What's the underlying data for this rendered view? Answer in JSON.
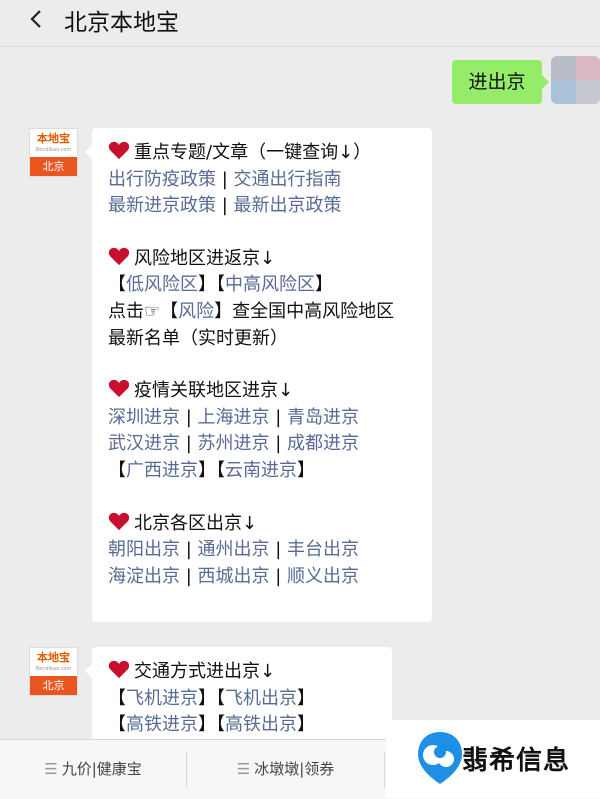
{
  "header": {
    "title": "北京本地宝"
  },
  "my_message": {
    "text": "进出京"
  },
  "bot_avatar": {
    "logo_text": "本地宝",
    "logo_domain": "Bendibao.com",
    "city": "北京"
  },
  "message1": {
    "sections": [
      {
        "lines": [
          [
            {
              "heart": true
            },
            {
              "t": "重点专题/文章（一键查询↓）",
              "c": "txt"
            }
          ],
          [
            {
              "t": "出行防疫政策",
              "c": "lnk"
            },
            {
              "t": " | ",
              "c": "txt"
            },
            {
              "t": "交通出行指南",
              "c": "lnk"
            }
          ],
          [
            {
              "t": "最新进京政策",
              "c": "lnk"
            },
            {
              "t": " | ",
              "c": "txt"
            },
            {
              "t": "最新出京政策",
              "c": "lnk"
            }
          ]
        ]
      },
      {
        "lines": [
          [
            {
              "heart": true
            },
            {
              "t": "风险地区进返京↓",
              "c": "txt"
            }
          ],
          [
            {
              "t": "【",
              "c": "txt"
            },
            {
              "t": "低风险区",
              "c": "lnk"
            },
            {
              "t": "】【",
              "c": "txt"
            },
            {
              "t": "中高风险区",
              "c": "lnk"
            },
            {
              "t": "】",
              "c": "txt"
            }
          ],
          [
            {
              "t": "点击☞【",
              "c": "txt"
            },
            {
              "t": "风险",
              "c": "lnk"
            },
            {
              "t": "】查全国中高风险地区",
              "c": "txt"
            }
          ],
          [
            {
              "t": "最新名单（实时更新）",
              "c": "txt"
            }
          ]
        ]
      },
      {
        "lines": [
          [
            {
              "heart": true
            },
            {
              "t": "疫情关联地区进京↓",
              "c": "txt"
            }
          ],
          [
            {
              "t": "深圳进京",
              "c": "lnk"
            },
            {
              "t": " | ",
              "c": "txt"
            },
            {
              "t": "上海进京",
              "c": "lnk"
            },
            {
              "t": " | ",
              "c": "txt"
            },
            {
              "t": "青岛进京",
              "c": "lnk"
            }
          ],
          [
            {
              "t": "武汉进京",
              "c": "lnk"
            },
            {
              "t": " | ",
              "c": "txt"
            },
            {
              "t": "苏州进京",
              "c": "lnk"
            },
            {
              "t": " | ",
              "c": "txt"
            },
            {
              "t": "成都进京",
              "c": "lnk"
            }
          ],
          [
            {
              "t": "【",
              "c": "txt"
            },
            {
              "t": "广西进京",
              "c": "lnk"
            },
            {
              "t": "】【",
              "c": "txt"
            },
            {
              "t": "云南进京",
              "c": "lnk"
            },
            {
              "t": "】",
              "c": "txt"
            }
          ]
        ]
      },
      {
        "lines": [
          [
            {
              "heart": true
            },
            {
              "t": "北京各区出京↓",
              "c": "txt"
            }
          ],
          [
            {
              "t": "朝阳出京",
              "c": "lnk"
            },
            {
              "t": " | ",
              "c": "txt"
            },
            {
              "t": "通州出京",
              "c": "lnk"
            },
            {
              "t": " | ",
              "c": "txt"
            },
            {
              "t": "丰台出京",
              "c": "lnk"
            }
          ],
          [
            {
              "t": "海淀出京",
              "c": "lnk"
            },
            {
              "t": " | ",
              "c": "txt"
            },
            {
              "t": "西城出京",
              "c": "lnk"
            },
            {
              "t": " | ",
              "c": "txt"
            },
            {
              "t": "顺义出京",
              "c": "lnk"
            }
          ]
        ]
      }
    ]
  },
  "message2": {
    "sections": [
      {
        "lines": [
          [
            {
              "heart": true
            },
            {
              "t": "交通方式进出京↓",
              "c": "txt"
            }
          ],
          [
            {
              "t": "【",
              "c": "txt"
            },
            {
              "t": "飞机进京",
              "c": "lnk"
            },
            {
              "t": "】【",
              "c": "txt"
            },
            {
              "t": "飞机出京",
              "c": "lnk"
            },
            {
              "t": "】",
              "c": "txt"
            }
          ],
          [
            {
              "t": "【",
              "c": "txt"
            },
            {
              "t": "高铁进京",
              "c": "lnk"
            },
            {
              "t": "】【",
              "c": "txt"
            },
            {
              "t": "高铁出京",
              "c": "lnk"
            },
            {
              "t": "】",
              "c": "txt"
            }
          ]
        ]
      }
    ]
  },
  "bottom_menu": {
    "items": [
      "九价|健康宝",
      "冰墩墩|领券"
    ]
  },
  "watermark": {
    "text": "翡希信息"
  },
  "colors": {
    "link": "#576b95",
    "my_bubble": "#95ec69",
    "heart": "#c8102e",
    "logo_orange": "#e8551f"
  }
}
